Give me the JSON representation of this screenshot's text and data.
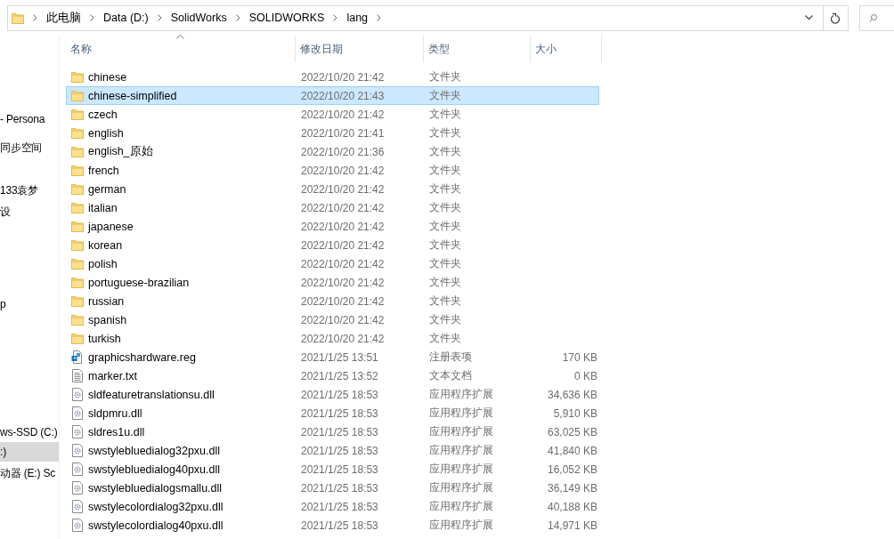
{
  "address_bar": {
    "path": [
      "此电脑",
      "Data (D:)",
      "SolidWorks",
      "SOLIDWORKS",
      "lang"
    ]
  },
  "sidebar": {
    "items": [
      {
        "label": "- Persona",
        "selected": false
      },
      {
        "label": "同步空间",
        "selected": false
      },
      {
        "label": "133袁梦",
        "selected": false
      },
      {
        "label": "设",
        "selected": false
      },
      {
        "label": "p",
        "selected": false
      },
      {
        "label": "ws-SSD (C:)",
        "selected": false
      },
      {
        "label": ":)",
        "selected": true
      },
      {
        "label": "动器 (E:) Sc",
        "selected": false
      }
    ]
  },
  "table": {
    "columns": [
      "名称",
      "修改日期",
      "类型",
      "大小"
    ],
    "rows": [
      {
        "kind": "folder",
        "name": "chinese",
        "date": "2022/10/20 21:42",
        "type": "文件夹",
        "size": "",
        "selected": false
      },
      {
        "kind": "folder",
        "name": "chinese-simplified",
        "date": "2022/10/20 21:43",
        "type": "文件夹",
        "size": "",
        "selected": true
      },
      {
        "kind": "folder",
        "name": "czech",
        "date": "2022/10/20 21:42",
        "type": "文件夹",
        "size": "",
        "selected": false
      },
      {
        "kind": "folder",
        "name": "english",
        "date": "2022/10/20 21:41",
        "type": "文件夹",
        "size": "",
        "selected": false
      },
      {
        "kind": "folder",
        "name": "english_原始",
        "date": "2022/10/20 21:36",
        "type": "文件夹",
        "size": "",
        "selected": false
      },
      {
        "kind": "folder",
        "name": "french",
        "date": "2022/10/20 21:42",
        "type": "文件夹",
        "size": "",
        "selected": false
      },
      {
        "kind": "folder",
        "name": "german",
        "date": "2022/10/20 21:42",
        "type": "文件夹",
        "size": "",
        "selected": false
      },
      {
        "kind": "folder",
        "name": "italian",
        "date": "2022/10/20 21:42",
        "type": "文件夹",
        "size": "",
        "selected": false
      },
      {
        "kind": "folder",
        "name": "japanese",
        "date": "2022/10/20 21:42",
        "type": "文件夹",
        "size": "",
        "selected": false
      },
      {
        "kind": "folder",
        "name": "korean",
        "date": "2022/10/20 21:42",
        "type": "文件夹",
        "size": "",
        "selected": false
      },
      {
        "kind": "folder",
        "name": "polish",
        "date": "2022/10/20 21:42",
        "type": "文件夹",
        "size": "",
        "selected": false
      },
      {
        "kind": "folder",
        "name": "portuguese-brazilian",
        "date": "2022/10/20 21:42",
        "type": "文件夹",
        "size": "",
        "selected": false
      },
      {
        "kind": "folder",
        "name": "russian",
        "date": "2022/10/20 21:42",
        "type": "文件夹",
        "size": "",
        "selected": false
      },
      {
        "kind": "folder",
        "name": "spanish",
        "date": "2022/10/20 21:42",
        "type": "文件夹",
        "size": "",
        "selected": false
      },
      {
        "kind": "folder",
        "name": "turkish",
        "date": "2022/10/20 21:42",
        "type": "文件夹",
        "size": "",
        "selected": false
      },
      {
        "kind": "registry",
        "name": "graphicshardware.reg",
        "date": "2021/1/25 13:51",
        "type": "注册表项",
        "size": "170 KB",
        "selected": false
      },
      {
        "kind": "text",
        "name": "marker.txt",
        "date": "2021/1/25 13:52",
        "type": "文本文档",
        "size": "0 KB",
        "selected": false
      },
      {
        "kind": "dll",
        "name": "sldfeaturetranslationsu.dll",
        "date": "2021/1/25 18:53",
        "type": "应用程序扩展",
        "size": "34,636 KB",
        "selected": false
      },
      {
        "kind": "dll",
        "name": "sldpmru.dll",
        "date": "2021/1/25 18:53",
        "type": "应用程序扩展",
        "size": "5,910 KB",
        "selected": false
      },
      {
        "kind": "dll",
        "name": "sldres1u.dll",
        "date": "2021/1/25 18:53",
        "type": "应用程序扩展",
        "size": "63,025 KB",
        "selected": false
      },
      {
        "kind": "dll",
        "name": "swstylebluedialog32pxu.dll",
        "date": "2021/1/25 18:53",
        "type": "应用程序扩展",
        "size": "41,840 KB",
        "selected": false
      },
      {
        "kind": "dll",
        "name": "swstylebluedialog40pxu.dll",
        "date": "2021/1/25 18:53",
        "type": "应用程序扩展",
        "size": "16,052 KB",
        "selected": false
      },
      {
        "kind": "dll",
        "name": "swstylebluedialogsmallu.dll",
        "date": "2021/1/25 18:53",
        "type": "应用程序扩展",
        "size": "36,149 KB",
        "selected": false
      },
      {
        "kind": "dll",
        "name": "swstylecolordialog32pxu.dll",
        "date": "2021/1/25 18:53",
        "type": "应用程序扩展",
        "size": "40,188 KB",
        "selected": false
      },
      {
        "kind": "dll",
        "name": "swstylecolordialog40pxu.dll",
        "date": "2021/1/25 18:53",
        "type": "应用程序扩展",
        "size": "14,971 KB",
        "selected": false
      }
    ]
  }
}
